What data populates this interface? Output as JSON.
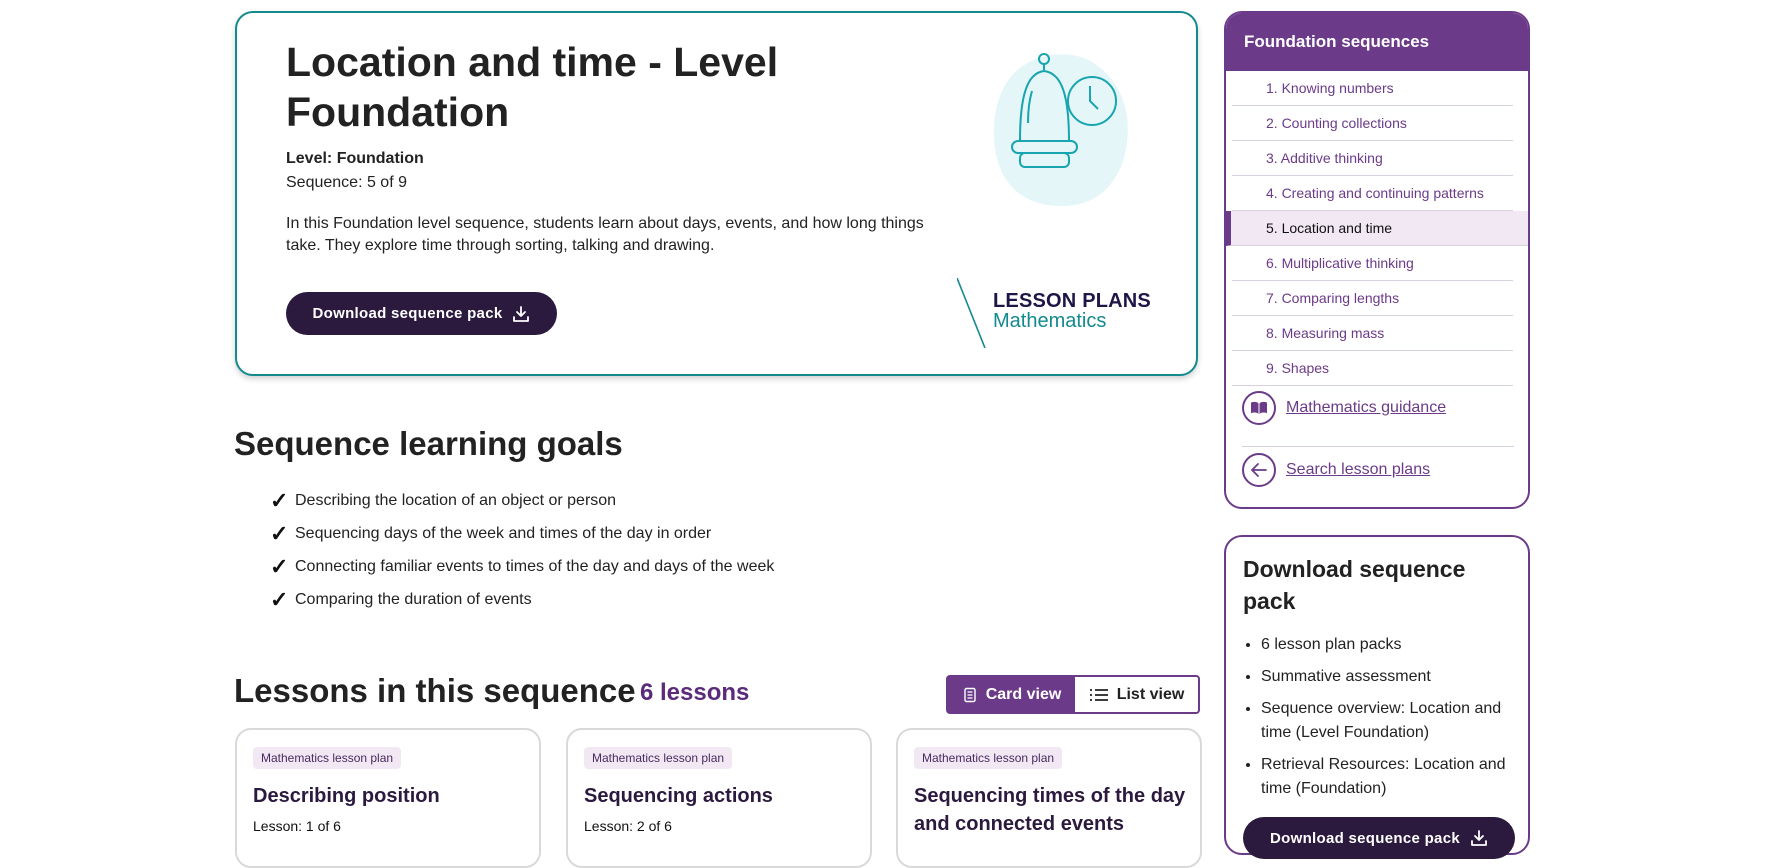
{
  "hero": {
    "title": "Location and time - Level Foundation",
    "level": "Level: Foundation",
    "sequence": "Sequence: 5 of 9",
    "description": "In this Foundation level sequence, students learn about days, events, and how long things take. They explore time through sorting, talking and drawing.",
    "download_button": "Download sequence pack",
    "brand_line1": "LESSON PLANS",
    "brand_line2": "Mathematics",
    "illustration_icon": "bell-clock-icon"
  },
  "goals": {
    "title": "Sequence learning goals",
    "items": [
      "Describing the location of an object or person",
      "Sequencing days of the week and times of the day in order",
      "Connecting familiar events to times of the day and days of the week",
      "Comparing the duration of events"
    ]
  },
  "lessons": {
    "title": "Lessons in this sequence",
    "count": "6 lessons",
    "view_card": "Card view",
    "view_list": "List view",
    "cards": [
      {
        "badge": "Mathematics lesson plan",
        "title": "Describing position",
        "lesson": "Lesson: 1 of 6"
      },
      {
        "badge": "Mathematics lesson plan",
        "title": "Sequencing actions",
        "lesson": "Lesson: 2 of 6"
      },
      {
        "badge": "Mathematics lesson plan",
        "title": "Sequencing times of the day and connected events",
        "lesson": ""
      }
    ]
  },
  "sidebar": {
    "heading": "Foundation sequences",
    "items": [
      "1. Knowing numbers",
      "2. Counting collections",
      "3. Additive thinking",
      "4. Creating and continuing patterns",
      "5. Location and time",
      "6. Multiplicative thinking",
      "7. Comparing lengths",
      "8. Measuring mass",
      "9. Shapes"
    ],
    "active_index": 4,
    "guidance_link": "Mathematics guidance",
    "search_link": "Search lesson plans"
  },
  "download_panel": {
    "title": "Download sequence pack",
    "items": [
      "6 lesson plan packs",
      "Summative assessment",
      "Sequence overview: Location and time (Level Foundation)",
      "Retrieval Resources: Location and time (Foundation)"
    ],
    "button": "Download sequence pack"
  },
  "colors": {
    "teal": "#138a8e",
    "purple": "#6b3b89",
    "dark_button": "#2b1a3e",
    "badge_bg": "#f1e8f4"
  }
}
